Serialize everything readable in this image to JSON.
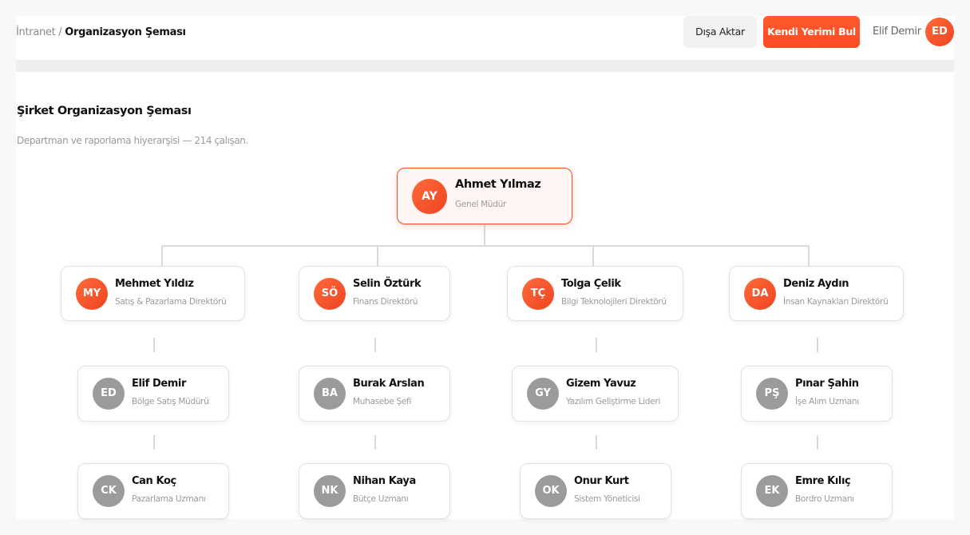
{
  "header": {
    "breadcrumb_parent": "İntranet",
    "breadcrumb_sep": "/",
    "breadcrumb_current": "Organizasyon Şeması",
    "export_label": "Dışa Aktar",
    "find_me_label": "Kendi Yerimi Bul",
    "user_name": "Elif Demir",
    "user_initials": "ED"
  },
  "page": {
    "title": "Şirket Organizasyon Şeması",
    "subtitle": "Departman ve raporlama hiyerarşisi — 214 çalışan."
  },
  "org": {
    "root": {
      "initials": "AY",
      "name": "Ahmet Yılmaz",
      "role": "Genel Müdür"
    },
    "directors": [
      {
        "initials": "MY",
        "name": "Mehmet Yıldız",
        "role": "Satış & Pazarlama Direktörü"
      },
      {
        "initials": "SÖ",
        "name": "Selin Öztürk",
        "role": "Finans Direktörü"
      },
      {
        "initials": "TÇ",
        "name": "Tolga Çelik",
        "role": "Bilgi Teknolojileri Direktörü"
      },
      {
        "initials": "DA",
        "name": "Deniz Aydın",
        "role": "İnsan Kaynakları Direktörü"
      }
    ],
    "managers": [
      {
        "initials": "ED",
        "name": "Elif Demir",
        "role": "Bölge Satış Müdürü"
      },
      {
        "initials": "BA",
        "name": "Burak Arslan",
        "role": "Muhasebe Şefi"
      },
      {
        "initials": "GY",
        "name": "Gizem Yavuz",
        "role": "Yazılım Geliştirme Lideri"
      },
      {
        "initials": "PŞ",
        "name": "Pınar Şahin",
        "role": "İşe Alım Uzmanı"
      }
    ],
    "staff": [
      {
        "initials": "CK",
        "name": "Can Koç",
        "role": "Pazarlama Uzmanı"
      },
      {
        "initials": "NK",
        "name": "Nihan Kaya",
        "role": "Bütçe Uzmanı"
      },
      {
        "initials": "OK",
        "name": "Onur Kurt",
        "role": "Sistem Yöneticisi"
      },
      {
        "initials": "EK",
        "name": "Emre Kılıç",
        "role": "Bordro Uzmanı"
      }
    ]
  },
  "colors": {
    "accent": "#ff4a24",
    "avatar_grey": "#9b9b9b"
  }
}
